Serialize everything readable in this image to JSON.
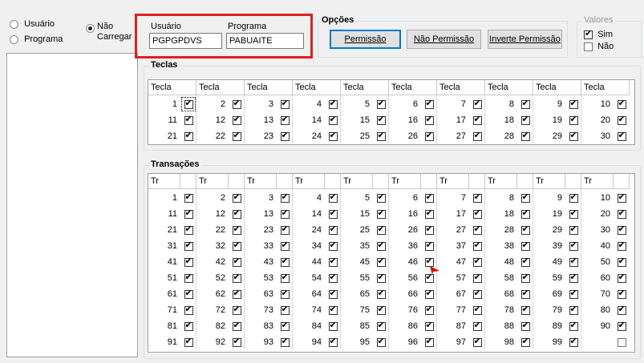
{
  "mode_radios": [
    {
      "label": "Usuário",
      "selected": false
    },
    {
      "label": "Programa",
      "selected": false
    },
    {
      "label": "Não\nCarregar",
      "label_line1": "Não",
      "label_line2": "Carregar",
      "selected": true
    }
  ],
  "filter": {
    "usuario_label": "Usuário",
    "usuario_value": "PGPGPDVS",
    "programa_label": "Programa",
    "programa_value": "PABUAITE",
    "highlight_color": "#e02020"
  },
  "opcoes": {
    "title": "Opções",
    "buttons": [
      "Permissão",
      "Não Permissão",
      "Inverte Permissão"
    ]
  },
  "valores": {
    "title": "Valores",
    "options": [
      {
        "label": "Sim",
        "checked": true
      },
      {
        "label": "Não",
        "checked": false
      }
    ]
  },
  "teclas": {
    "title": "Teclas",
    "column_header": "Tecla",
    "rows": [
      [
        "1",
        "2",
        "3",
        "4",
        "5",
        "6",
        "7",
        "8",
        "9",
        "10"
      ],
      [
        "11",
        "12",
        "13",
        "14",
        "15",
        "16",
        "17",
        "18",
        "19",
        "20"
      ],
      [
        "21",
        "22",
        "23",
        "24",
        "25",
        "26",
        "27",
        "28",
        "29",
        "30"
      ]
    ]
  },
  "transacoes": {
    "title": "Transações",
    "column_header": "Tr",
    "rows": [
      [
        "1",
        "2",
        "3",
        "4",
        "5",
        "6",
        "7",
        "8",
        "9",
        "10"
      ],
      [
        "11",
        "12",
        "13",
        "14",
        "15",
        "16",
        "17",
        "18",
        "19",
        "20"
      ],
      [
        "21",
        "22",
        "23",
        "24",
        "25",
        "26",
        "27",
        "28",
        "29",
        "30"
      ],
      [
        "31",
        "32",
        "33",
        "34",
        "35",
        "36",
        "37",
        "38",
        "39",
        "40"
      ],
      [
        "41",
        "42",
        "43",
        "44",
        "45",
        "46",
        "47",
        "48",
        "49",
        "50"
      ],
      [
        "51",
        "52",
        "53",
        "54",
        "55",
        "56",
        "57",
        "58",
        "59",
        "60"
      ],
      [
        "61",
        "62",
        "63",
        "64",
        "65",
        "66",
        "67",
        "68",
        "69",
        "70"
      ],
      [
        "71",
        "72",
        "73",
        "74",
        "75",
        "76",
        "77",
        "78",
        "79",
        "80"
      ],
      [
        "81",
        "82",
        "83",
        "84",
        "85",
        "86",
        "87",
        "88",
        "89",
        "90"
      ],
      [
        "91",
        "92",
        "93",
        "94",
        "95",
        "96",
        "97",
        "98",
        "99",
        ""
      ]
    ],
    "last_cell_checked": false
  },
  "cursor_color": "#e00000"
}
